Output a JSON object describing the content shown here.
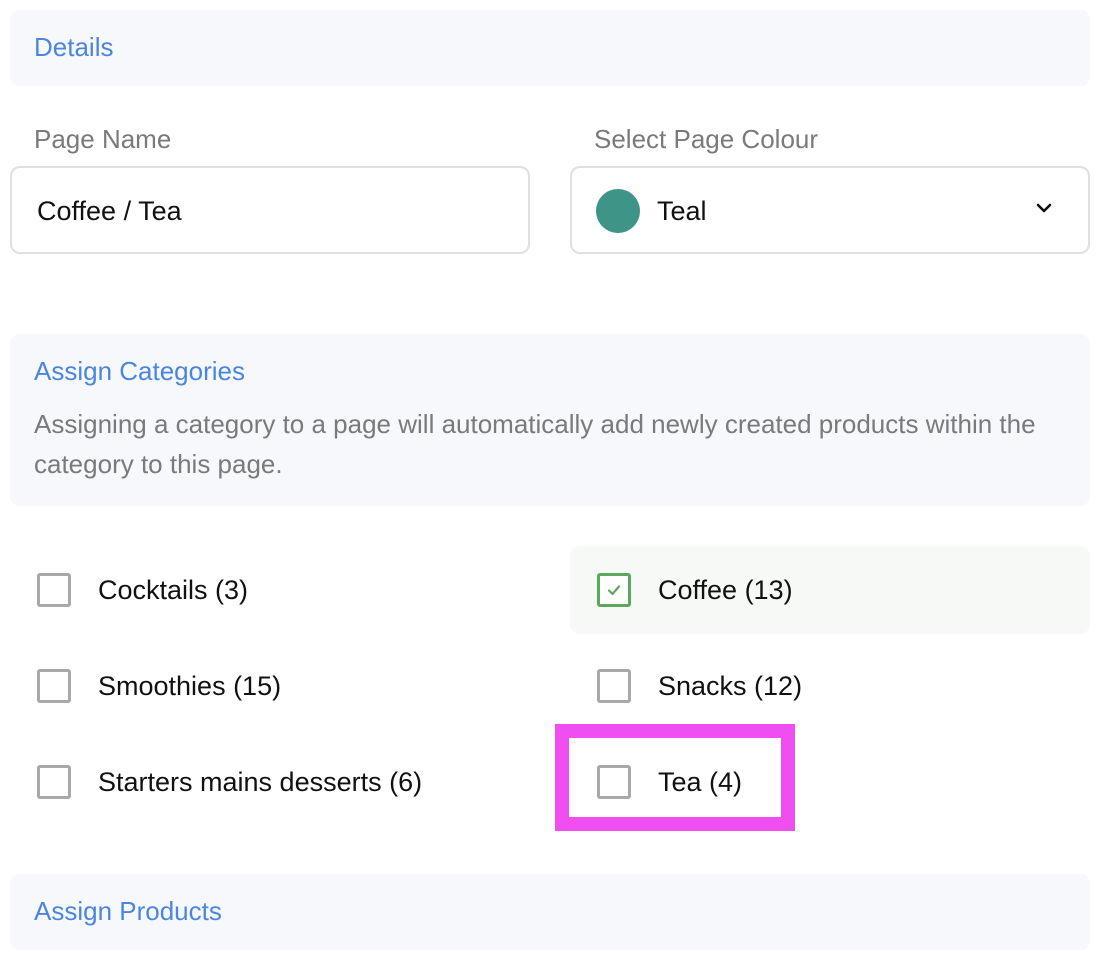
{
  "details": {
    "title": "Details"
  },
  "page_name": {
    "label": "Page Name",
    "value": "Coffee / Tea"
  },
  "page_colour": {
    "label": "Select Page Colour",
    "value": "Teal",
    "swatch_color": "#3e9487",
    "icon": "chevron-down-icon"
  },
  "categories": {
    "title": "Assign Categories",
    "description": "Assigning a category to a page will automatically add newly created products within the category to this page.",
    "items": [
      {
        "label": "Cocktails (3)",
        "checked": false
      },
      {
        "label": "Coffee (13)",
        "checked": true
      },
      {
        "label": "Smoothies (15)",
        "checked": false
      },
      {
        "label": "Snacks (12)",
        "checked": false
      },
      {
        "label": "Starters mains desserts (6)",
        "checked": false
      },
      {
        "label": "Tea (4)",
        "checked": false,
        "highlighted": true
      }
    ]
  },
  "products": {
    "title": "Assign Products"
  },
  "colors": {
    "accent": "#4a86e0",
    "check": "#5ca85c",
    "highlight": "#f04ef0"
  }
}
